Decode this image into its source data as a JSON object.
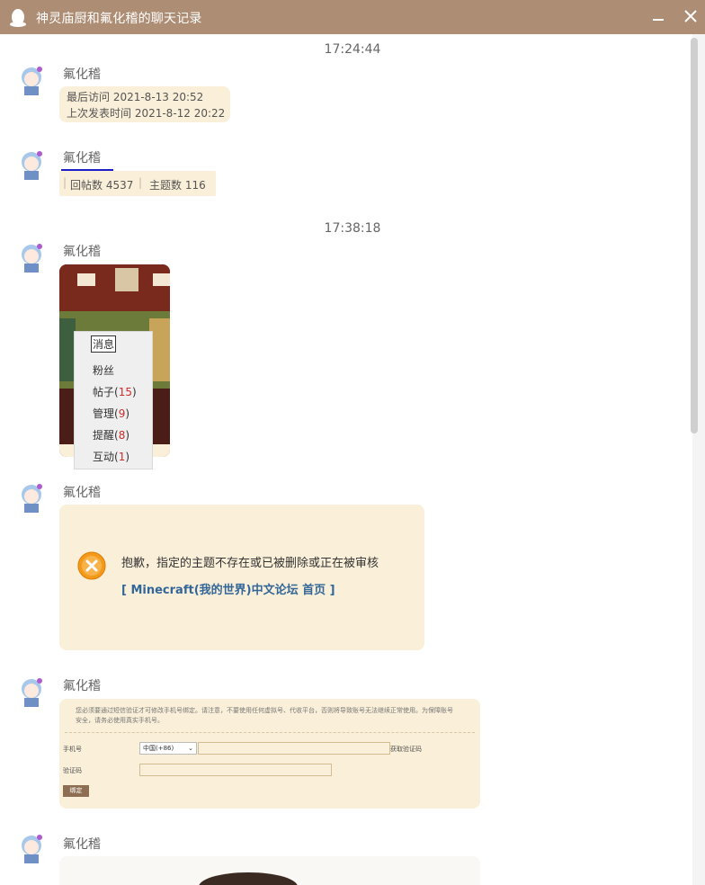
{
  "window": {
    "title": "神灵庙厨和氟化稽的聊天记录"
  },
  "times": [
    "17:24:44",
    "17:38:18"
  ],
  "sender": "氟化稽",
  "msg1": {
    "line1": "最后访问   2021-8-13 20:52",
    "line2": "上次发表时间   2021-8-12 20:22"
  },
  "msg2": {
    "posts": "回帖数 4537",
    "topics": "主题数 116"
  },
  "msg3": {
    "menu_title": "消息",
    "items": [
      "粉丝",
      "帖子",
      "管理",
      "提醒",
      "互动"
    ],
    "counts": [
      "",
      "15",
      "9",
      "8",
      "1"
    ]
  },
  "msg4": {
    "error_text": "抱歉，指定的主题不存在或已被删除或正在被审核",
    "link_text": "[ Minecraft(我的世界)中文论坛 首页 ]"
  },
  "msg5": {
    "notice": "您必须要通过短信验证才可修改手机号绑定。请注意，不要使用任何虚拟号、代收平台，否则将导致账号无法继续正常使用。为保障账号安全，请务必使用真实手机号。",
    "phone_label": "手机号",
    "country_option": "中国(+86)",
    "get_code": "获取验证码",
    "code_label": "验证码",
    "bind_button": "绑定"
  },
  "colors": {
    "titlebar": "#ad8d74",
    "bubble": "#faefd8",
    "link": "#336699",
    "error_orange": "#f39a1b"
  }
}
